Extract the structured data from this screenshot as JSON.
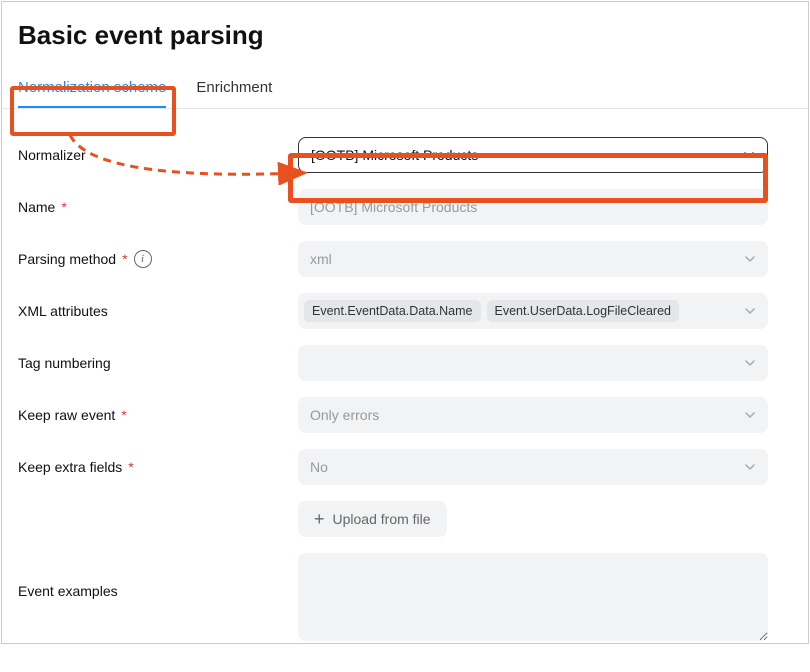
{
  "header": {
    "title": "Basic event parsing"
  },
  "tabs": {
    "items": [
      {
        "label": "Normalization scheme",
        "active": true
      },
      {
        "label": "Enrichment",
        "active": false
      }
    ]
  },
  "form": {
    "normalizer": {
      "label": "Normalizer",
      "value": "[OOTB] Microsoft Products"
    },
    "name": {
      "label": "Name",
      "required": "*",
      "value": "[OOTB] Microsoft Products"
    },
    "parsing_method": {
      "label": "Parsing method",
      "required": "*",
      "value": "xml"
    },
    "xml_attributes": {
      "label": "XML attributes",
      "chip1": "Event.EventData.Data.Name",
      "chip2": "Event.UserData.LogFileCleared"
    },
    "tag_numbering": {
      "label": "Tag numbering",
      "value": ""
    },
    "keep_raw_event": {
      "label": "Keep raw event",
      "required": "*",
      "value": "Only errors"
    },
    "keep_extra_fields": {
      "label": "Keep extra fields",
      "required": "*",
      "value": "No"
    },
    "upload": {
      "label": "Upload from file"
    },
    "event_examples": {
      "label": "Event examples",
      "value": ""
    }
  }
}
